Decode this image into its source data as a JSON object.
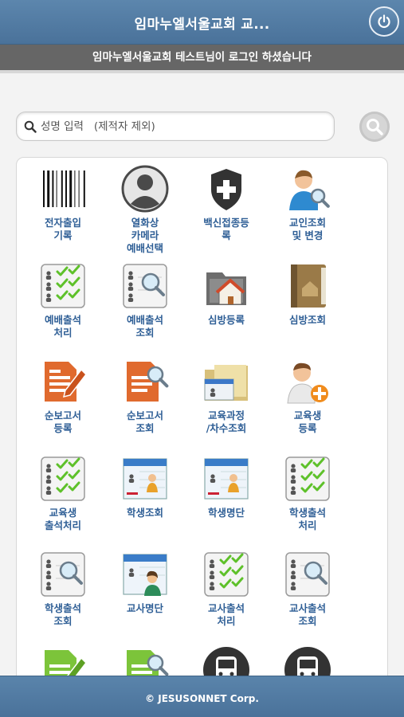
{
  "header": {
    "title": "임마누엘서울교회 교...",
    "power_icon": "power-icon"
  },
  "login_bar": {
    "message": "임마누엘서울교회 테스트님이 로그인 하셨습니다"
  },
  "search": {
    "placeholder": "성명 입력   (제적자 제외)",
    "value": ""
  },
  "menu": [
    {
      "label": "전자출입\n기록",
      "icon": "barcode-icon"
    },
    {
      "label": "열화상\n카메라\n예배선택",
      "icon": "user-circle-icon"
    },
    {
      "label": "백신접종등\n록",
      "icon": "shield-plus-icon"
    },
    {
      "label": "교인조회\n및 변경",
      "icon": "person-search-icon"
    },
    {
      "label": "예배출석\n처리",
      "icon": "attendance-check-icon"
    },
    {
      "label": "예배출석\n조회",
      "icon": "attendance-search-icon"
    },
    {
      "label": "심방등록",
      "icon": "house-folder-icon"
    },
    {
      "label": "심방조회",
      "icon": "house-book-icon"
    },
    {
      "label": "순보고서\n등록",
      "icon": "report-edit-icon"
    },
    {
      "label": "순보고서\n조회",
      "icon": "report-search-icon"
    },
    {
      "label": "교육과정\n/차수조회",
      "icon": "education-folder-icon"
    },
    {
      "label": "교육생\n등록",
      "icon": "person-add-icon"
    },
    {
      "label": "교육생\n출석처리",
      "icon": "attendance-check-icon"
    },
    {
      "label": "학생조회",
      "icon": "student-board-icon"
    },
    {
      "label": "학생명단",
      "icon": "student-board-icon"
    },
    {
      "label": "학생출석\n처리",
      "icon": "attendance-check-icon"
    },
    {
      "label": "학생출석\n조회",
      "icon": "attendance-search-icon"
    },
    {
      "label": "교사명단",
      "icon": "teacher-board-icon"
    },
    {
      "label": "교사출석\n처리",
      "icon": "attendance-check-icon"
    },
    {
      "label": "교사출석\n조회",
      "icon": "attendance-search-icon"
    },
    {
      "label": "",
      "icon": "green-report-edit-icon"
    },
    {
      "label": "",
      "icon": "green-report-search-icon"
    },
    {
      "label": "",
      "icon": "bus-icon"
    },
    {
      "label": "",
      "icon": "bus-icon"
    }
  ],
  "footer": {
    "text": "© JESUSONNET Corp."
  },
  "colors": {
    "header": "#4a729a",
    "login_bar": "#666666",
    "label": "#2f5f96"
  }
}
